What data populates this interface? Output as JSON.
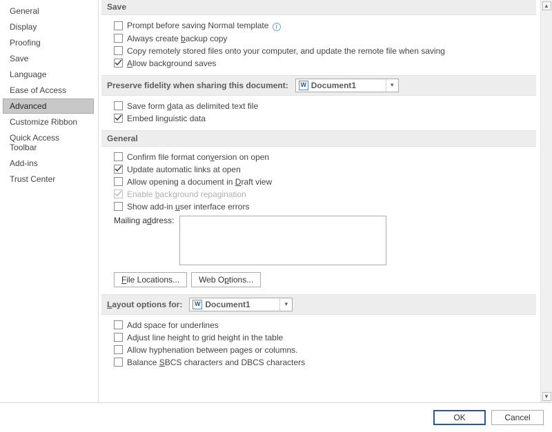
{
  "sidebar": {
    "items": [
      {
        "label": "General"
      },
      {
        "label": "Display"
      },
      {
        "label": "Proofing"
      },
      {
        "label": "Save"
      },
      {
        "label": "Language"
      },
      {
        "label": "Ease of Access"
      },
      {
        "label": "Advanced"
      },
      {
        "label": "Customize Ribbon"
      },
      {
        "label": "Quick Access Toolbar"
      },
      {
        "label": "Add-ins"
      },
      {
        "label": "Trust Center"
      }
    ],
    "selected_index": 6
  },
  "sections": {
    "save": {
      "title": "Save",
      "prompt_normal": "Prompt before saving Normal template",
      "backup_copy": "Always create backup copy",
      "copy_remote": "Copy remotely stored files onto your computer, and update the remote file when saving",
      "bg_saves": "Allow background saves"
    },
    "fidelity": {
      "title": "Preserve fidelity when sharing this document:",
      "combo_value": "Document1",
      "save_form_data": "Save form data as delimited text file",
      "embed_linguistic": "Embed linguistic data"
    },
    "general": {
      "title": "General",
      "confirm_conversion": "Confirm file format conversion on open",
      "update_links": "Update automatic links at open",
      "draft_view": "Allow opening a document in Draft view",
      "bg_repag": "Enable background repagination",
      "show_addin_errors": "Show add-in user interface errors",
      "mailing_label": "Mailing address:",
      "file_locations_btn": "File Locations...",
      "web_options_btn": "Web Options..."
    },
    "layout": {
      "title": "Layout options for:",
      "combo_value": "Document1",
      "add_space_underlines": "Add space for underlines",
      "adjust_line_height": "Adjust line height to grid height in the table",
      "allow_hyphenation": "Allow hyphenation between pages or columns.",
      "balance_sbcs": "Balance SBCS characters and DBCS characters"
    }
  },
  "checks": {
    "prompt_normal": false,
    "backup_copy": false,
    "copy_remote": false,
    "bg_saves": true,
    "save_form_data": false,
    "embed_linguistic": true,
    "confirm_conversion": false,
    "update_links": true,
    "draft_view": false,
    "bg_repag": true,
    "show_addin_errors": false,
    "add_space_underlines": false,
    "adjust_line_height": false,
    "allow_hyphenation": false,
    "balance_sbcs": false
  },
  "footer": {
    "ok": "OK",
    "cancel": "Cancel"
  }
}
